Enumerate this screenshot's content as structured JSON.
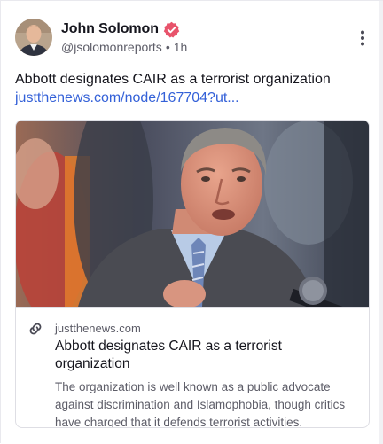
{
  "post": {
    "author": {
      "display_name": "John Solomon",
      "handle": "@jsolomonreports",
      "separator": "•",
      "timestamp": "1h",
      "verified_badge": "verified-check-icon",
      "verified_color": "#e8536b"
    },
    "menu_icon": "more-vertical-icon",
    "text": "Abbott designates CAIR as a terrorist organization",
    "link_text": "justthenews.com/node/167704?ut...",
    "link_color": "#3461d8",
    "embed": {
      "image_icon": "photo-speaker-at-microphone",
      "link_icon": "link-icon",
      "domain": "justthenews.com",
      "title": "Abbott designates CAIR as a terrorist organization",
      "description": "The organization is well known as a public advocate against discrimination and Islamophobia, though critics have charged that it defends terrorist activities."
    }
  }
}
